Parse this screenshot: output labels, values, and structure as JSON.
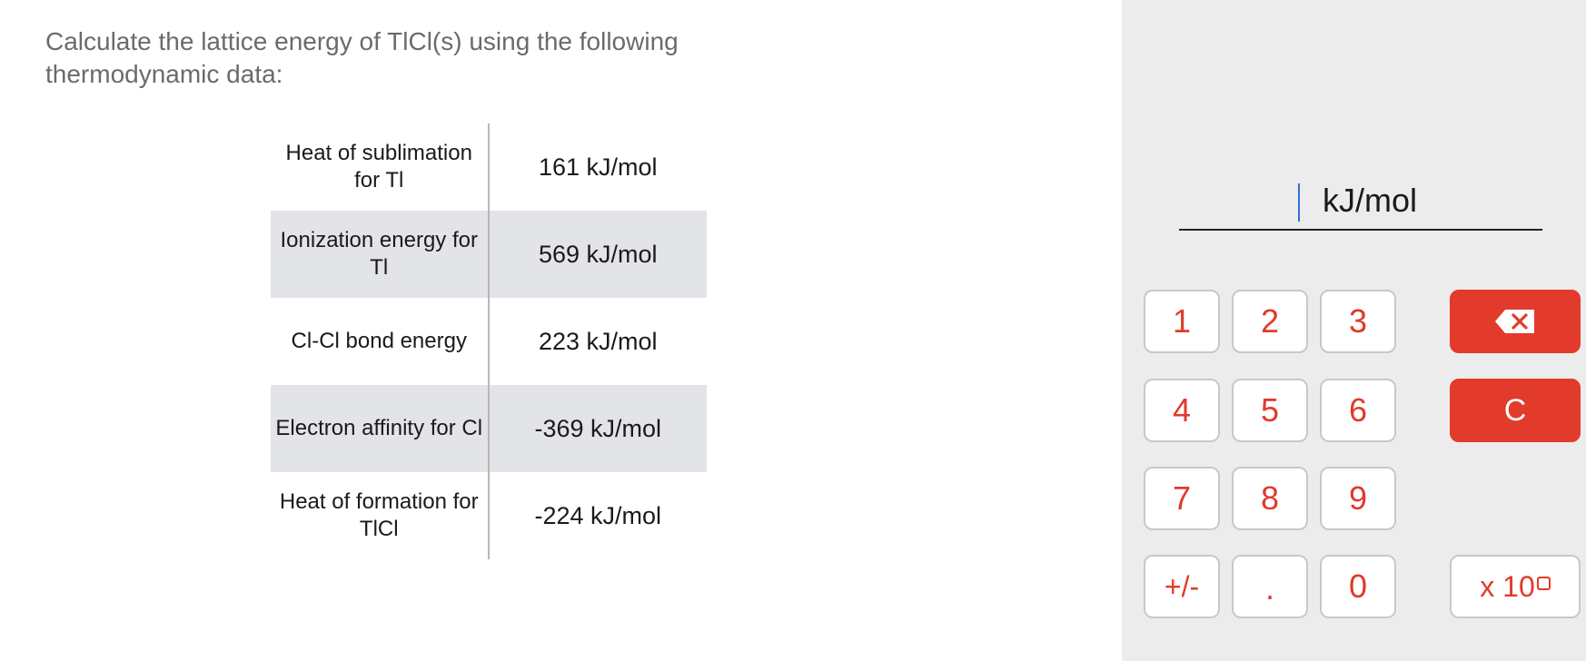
{
  "question": "Calculate the lattice energy of TlCl(s) using the following thermodynamic data:",
  "table": [
    {
      "label": "Heat of sublimation for Tl",
      "value": "161 kJ/mol"
    },
    {
      "label": "Ionization energy for Tl",
      "value": "569 kJ/mol"
    },
    {
      "label": "Cl-Cl bond energy",
      "value": "223 kJ/mol"
    },
    {
      "label": "Electron affinity for Cl",
      "value": "-369 kJ/mol"
    },
    {
      "label": "Heat of formation for TlCl",
      "value": "-224 kJ/mol"
    }
  ],
  "answer": {
    "value": "",
    "unit": "kJ/mol"
  },
  "keypad": {
    "k1": "1",
    "k2": "2",
    "k3": "3",
    "k4": "4",
    "k5": "5",
    "k6": "6",
    "k7": "7",
    "k8": "8",
    "k9": "9",
    "sign": "+/-",
    "dot": ".",
    "k0": "0",
    "clear": "C",
    "exp": "x 10",
    "backspace_icon": "backspace-icon"
  },
  "colors": {
    "accent": "#e23b2b",
    "panel": "#ececec",
    "row_alt": "#e3e4e8"
  }
}
